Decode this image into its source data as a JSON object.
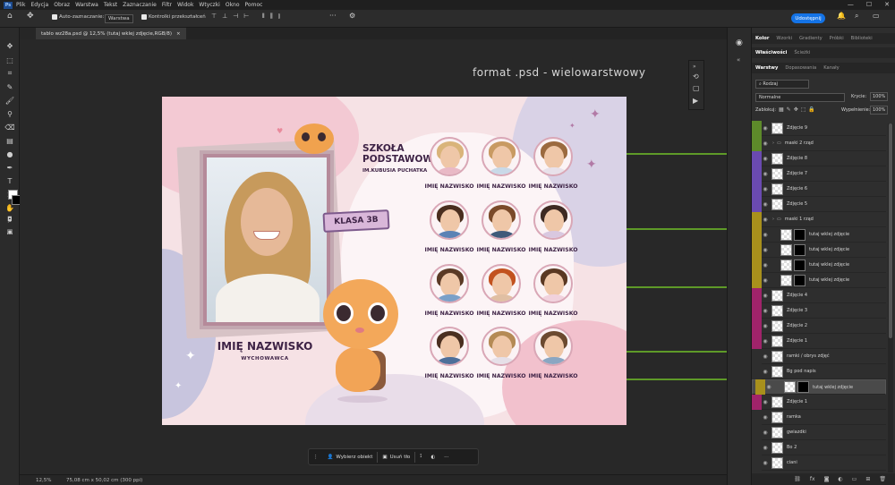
{
  "menubar": {
    "logo": "Ps",
    "items": [
      "Plik",
      "Edycja",
      "Obraz",
      "Warstwa",
      "Tekst",
      "Zaznaczanie",
      "Filtr",
      "Widok",
      "Wtyczki",
      "Okno",
      "Pomoc"
    ]
  },
  "options": {
    "auto_select": "Auto-zaznaczanie:",
    "auto_select_target": "Warstwa",
    "transform_controls": "Kontrolki przekształceń",
    "share": "Udostępnij"
  },
  "doc_tab": {
    "title": "tablo wz28a.psd @ 12,5% (tutaj wklej zdjęcie,RGB/8)",
    "close": "×"
  },
  "canvas": {
    "heading": "format .psd - wielowarstwowy"
  },
  "tablo": {
    "school_line1": "SZKOŁA",
    "school_line2": "PODSTAWOWA",
    "school_line3": "IM.KUBUSIA PUCHATKA",
    "class_label": "KLASA 3B",
    "teacher_name": "IMIĘ NAZWISKO",
    "teacher_role": "WYCHOWAWCA",
    "student_label": "IMIĘ NAZWISKO"
  },
  "students": [
    {
      "label": "IMIĘ NAZWISKO",
      "hair": "#d9b47a",
      "shirt": "#e9b9c6"
    },
    {
      "label": "IMIĘ NAZWISKO",
      "hair": "#c89a62",
      "shirt": "#c9d9e8"
    },
    {
      "label": "IMIĘ NAZWISKO",
      "hair": "#9b6a3f",
      "shirt": "#e8e1ea"
    },
    {
      "label": "IMIĘ NAZWISKO",
      "hair": "#4a2e1f",
      "shirt": "#5b82b5"
    },
    {
      "label": "IMIĘ NAZWISKO",
      "hair": "#7a4a2a",
      "shirt": "#3f5a7a"
    },
    {
      "label": "IMIĘ NAZWISKO",
      "hair": "#3e2a22",
      "shirt": "#d9c8e0"
    },
    {
      "label": "IMIĘ NAZWISKO",
      "hair": "#5b3a26",
      "shirt": "#7aa0c8"
    },
    {
      "label": "IMIĘ NAZWISKO",
      "hair": "#c2521f",
      "shirt": "#e0bfa3"
    },
    {
      "label": "IMIĘ NAZWISKO",
      "hair": "#5a3822",
      "shirt": "#f1d2dd"
    },
    {
      "label": "IMIĘ NAZWISKO",
      "hair": "#4a2f20",
      "shirt": "#4d6f9a"
    },
    {
      "label": "IMIĘ NAZWISKO",
      "hair": "#b48a55",
      "shirt": "#e6e0e8"
    },
    {
      "label": "IMIĘ NAZWISKO",
      "hair": "#6b4a30",
      "shirt": "#8aa6c2"
    }
  ],
  "context_bar": {
    "select_subject": "Wybierz obiekt",
    "remove_bg": "Usuń tło",
    "more": "···"
  },
  "status": {
    "zoom": "12,5%",
    "dimensions": "75,08 cm x 50,02 cm (300 ppi)"
  },
  "panel": {
    "tabs1": [
      "Kolor",
      "Wzorki",
      "Gradienty",
      "Próbki",
      "Biblioteki"
    ],
    "tabs2": [
      "Właściwości",
      "Ścieżki"
    ],
    "tabs3": [
      "Warstwy",
      "Dopasowania",
      "Kanały"
    ],
    "filter": "Rodzaj",
    "blend": "Normalne",
    "opacity_label": "Krycie:",
    "opacity": "100%",
    "lock_label": "Zablokuj:",
    "fill_label": "Wypełnienie:",
    "fill": "100%"
  },
  "layers": [
    {
      "name": "Zdjęcie 9",
      "color": "#5d8a2a",
      "type": "img"
    },
    {
      "name": "maski 2 rząd",
      "color": "#5d8a2a",
      "type": "folder"
    },
    {
      "name": "Zdjęcie 8",
      "color": "#6a4ab0",
      "type": "img"
    },
    {
      "name": "Zdjęcie 7",
      "color": "#6a4ab0",
      "type": "img"
    },
    {
      "name": "Zdjęcie 6",
      "color": "#6a4ab0",
      "type": "img"
    },
    {
      "name": "Zdjęcie 5",
      "color": "#6a4ab0",
      "type": "img"
    },
    {
      "name": "maski 1 rząd",
      "color": "#a8901c",
      "type": "folder"
    },
    {
      "name": "tutaj wklej zdjęcie",
      "color": "#a8901c",
      "type": "mask"
    },
    {
      "name": "tutaj wklej zdjęcie",
      "color": "#a8901c",
      "type": "mask"
    },
    {
      "name": "tutaj wklej zdjęcie",
      "color": "#a8901c",
      "type": "mask"
    },
    {
      "name": "tutaj wklej zdjęcie",
      "color": "#a8901c",
      "type": "mask"
    },
    {
      "name": "Zdjęcie 4",
      "color": "#a0236a",
      "type": "img"
    },
    {
      "name": "Zdjęcie 3",
      "color": "#a0236a",
      "type": "img"
    },
    {
      "name": "Zdjęcie 2",
      "color": "#a0236a",
      "type": "img"
    },
    {
      "name": "Zdjęcie 1",
      "color": "#a0236a",
      "type": "img"
    },
    {
      "name": "ramki / obrys zdjęć",
      "color": "#2e2e2e",
      "type": "img"
    },
    {
      "name": "Bg pod napis",
      "color": "#2e2e2e",
      "type": "img"
    },
    {
      "name": "tutaj wklej zdjęcie",
      "color": "#a8901c",
      "type": "mask"
    },
    {
      "name": "Zdjęcie 1",
      "color": "#a0236a",
      "type": "img"
    },
    {
      "name": "ramka",
      "color": "#2e2e2e",
      "type": "img"
    },
    {
      "name": "gwiazdki",
      "color": "#2e2e2e",
      "type": "img"
    },
    {
      "name": "Bo 2",
      "color": "#2e2e2e",
      "type": "img"
    },
    {
      "name": "ciani",
      "color": "#2e2e2e",
      "type": "img"
    }
  ]
}
